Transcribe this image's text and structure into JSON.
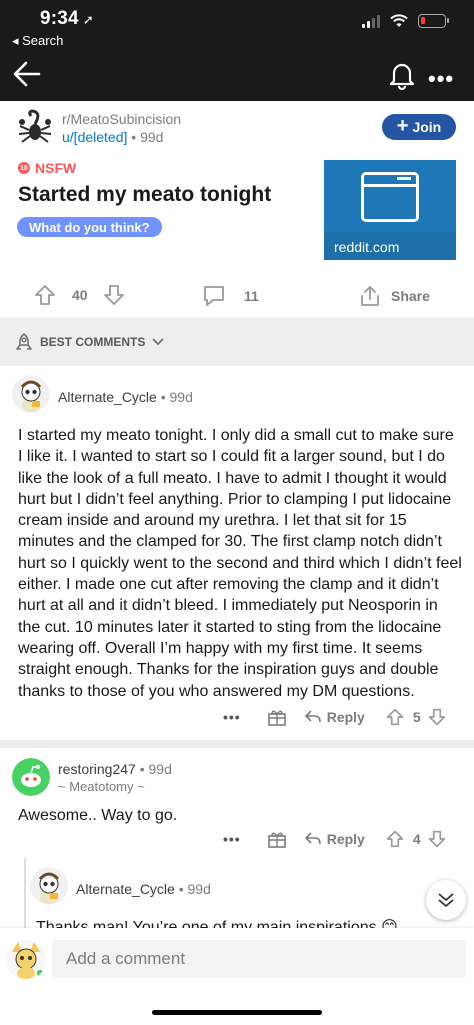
{
  "status_bar": {
    "time": "9:34",
    "back_label": "◂ Search"
  },
  "post": {
    "subreddit": "r/MeatoSubincision",
    "author": "u/[deleted]",
    "age": "99d",
    "join_label": "Join",
    "nsfw_label": "NSFW",
    "title": "Started my meato tonight",
    "flair": "What do you think?",
    "link_domain": "reddit.com",
    "upvotes": "40",
    "comments": "11",
    "share_label": "Share"
  },
  "sort_label": "BEST COMMENTS",
  "comments": [
    {
      "author": "Alternate_Cycle",
      "age": "99d",
      "body": "I started my meato tonight. I only did a small cut to make sure I like it. I wanted to start so I could fit a larger sound, but I do like the look of a full meato. I have to admit I thought it would hurt but I didn’t feel anything. Prior to clamping I put lidocaine cream inside and around my urethra. I let that sit for 15 minutes and the clamped for 30. The first clamp notch didn’t hurt so I quickly went to the second and third which I didn’t feel either. I made one cut after removing the clamp and it didn’t hurt at all and it didn’t bleed. I immediately put Neosporin in the cut. 10 minutes later it started to sting from the lidocaine wearing off. Overall I’m happy with my first time. It seems straight enough. Thanks for the inspiration guys and double thanks to those of you who answered my DM questions.",
      "reply_label": "Reply",
      "votes": "5"
    },
    {
      "author": "restoring247",
      "age": "99d",
      "flair": "~ Meatotomy ~",
      "body": "Awesome.. Way to go.",
      "reply_label": "Reply",
      "votes": "4"
    },
    {
      "author": "Alternate_Cycle",
      "age": "99d",
      "body": "Thanks man! You’re one of my main inspirations 😊"
    }
  ],
  "composer": {
    "placeholder": "Add a comment"
  },
  "colors": {
    "join": "#2456a4",
    "nsfw": "#ff585b",
    "flair": "#7193ff",
    "link": "#0079d3"
  }
}
